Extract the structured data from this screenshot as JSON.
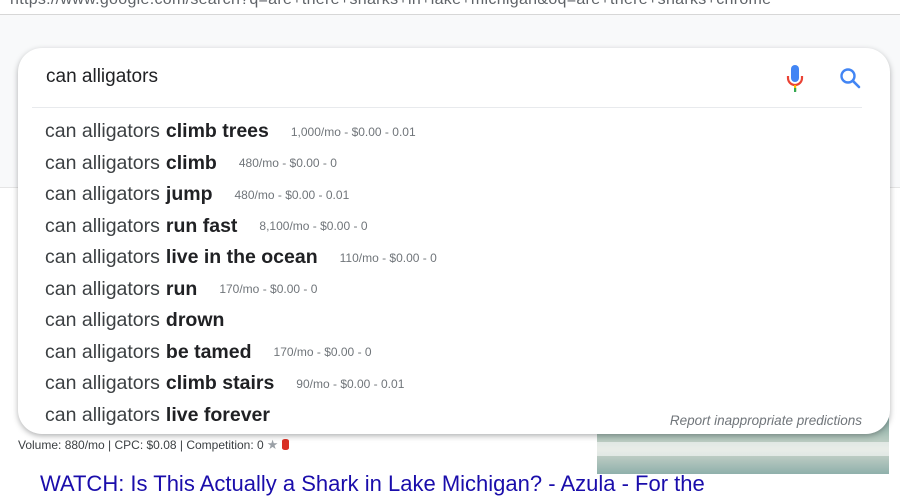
{
  "browser": {
    "url": "https://www.google.com/search?q=are+there+sharks+in+lake+michigan&oq=are+there+sharks+chrome"
  },
  "search": {
    "query": "can alligators",
    "report_label": "Report inappropriate predictions"
  },
  "suggestions": [
    {
      "prefix": "can alligators",
      "completion": "climb trees",
      "stats": "1,000/mo - $0.00 - 0.01"
    },
    {
      "prefix": "can alligators",
      "completion": "climb",
      "stats": "480/mo - $0.00 - 0"
    },
    {
      "prefix": "can alligators",
      "completion": "jump",
      "stats": "480/mo - $0.00 - 0.01"
    },
    {
      "prefix": "can alligators",
      "completion": "run fast",
      "stats": "8,100/mo - $0.00 - 0"
    },
    {
      "prefix": "can alligators",
      "completion": "live in the ocean",
      "stats": "110/mo - $0.00 - 0"
    },
    {
      "prefix": "can alligators",
      "completion": "run",
      "stats": "170/mo - $0.00 - 0"
    },
    {
      "prefix": "can alligators",
      "completion": "drown",
      "stats": ""
    },
    {
      "prefix": "can alligators",
      "completion": "be tamed",
      "stats": "170/mo - $0.00 - 0"
    },
    {
      "prefix": "can alligators",
      "completion": "climb stairs",
      "stats": "90/mo - $0.00 - 0.01"
    },
    {
      "prefix": "can alligators",
      "completion": "live forever",
      "stats": ""
    }
  ],
  "background_result": {
    "stats": "Volume: 880/mo | CPC: $0.08 | Competition: 0",
    "title": "WATCH: Is This Actually a Shark in Lake Michigan? - Azula - For the"
  },
  "icons": {
    "mic": "microphone-icon",
    "search": "search-icon",
    "star": "star-icon",
    "db": "database-icon"
  },
  "colors": {
    "google_blue": "#4285f4",
    "google_red": "#ea4335",
    "link_blue": "#1a0dab"
  }
}
